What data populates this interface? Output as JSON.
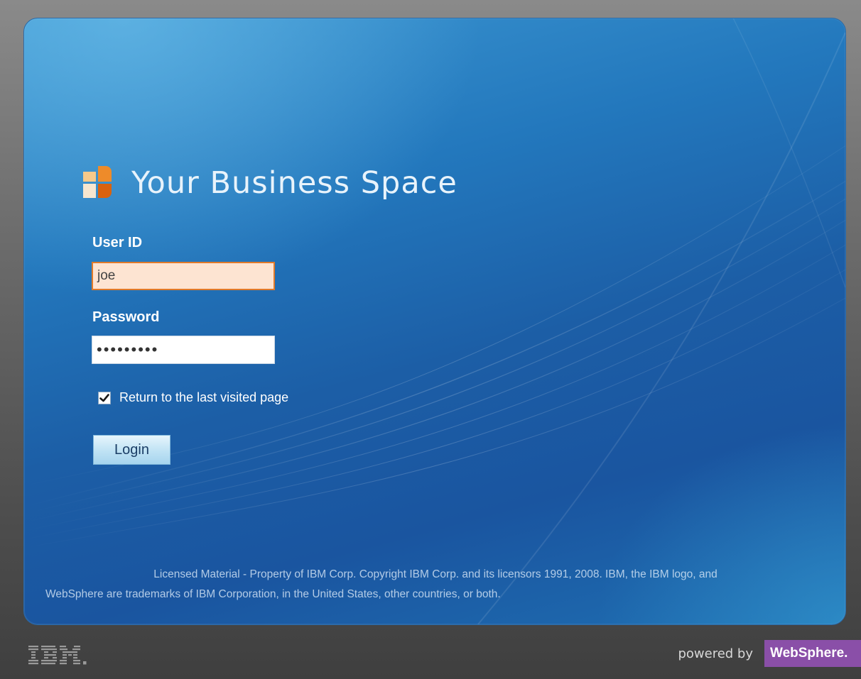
{
  "brand": {
    "title": "Your Business Space",
    "logo_icon": "business-space-logo-icon",
    "colors": {
      "logo_orange": "#e8731a",
      "logo_light": "#f6c98a"
    }
  },
  "form": {
    "user_id_label": "User ID",
    "user_id_value": "joe",
    "password_label": "Password",
    "password_value": "•••••••••",
    "remember_label": "Return to the last visited page",
    "remember_checked": true,
    "login_label": "Login"
  },
  "footer": {
    "copyright_line1": "Licensed Material - Property of IBM Corp. Copyright IBM Corp. and its licensors 1991, 2008. IBM, the IBM logo, and",
    "copyright_line2": "WebSphere are trademarks of IBM Corporation, in the United States, other countries, or both.",
    "ibm_logo_text": "IBM.",
    "powered_by": "powered by",
    "websphere_badge": "WebSphere."
  },
  "colors": {
    "panel_blue": "#1f6fb2",
    "input_focus_border": "#e07a2a",
    "input_focus_bg": "#fde4d2",
    "websphere_purple": "#8a4fa8"
  }
}
